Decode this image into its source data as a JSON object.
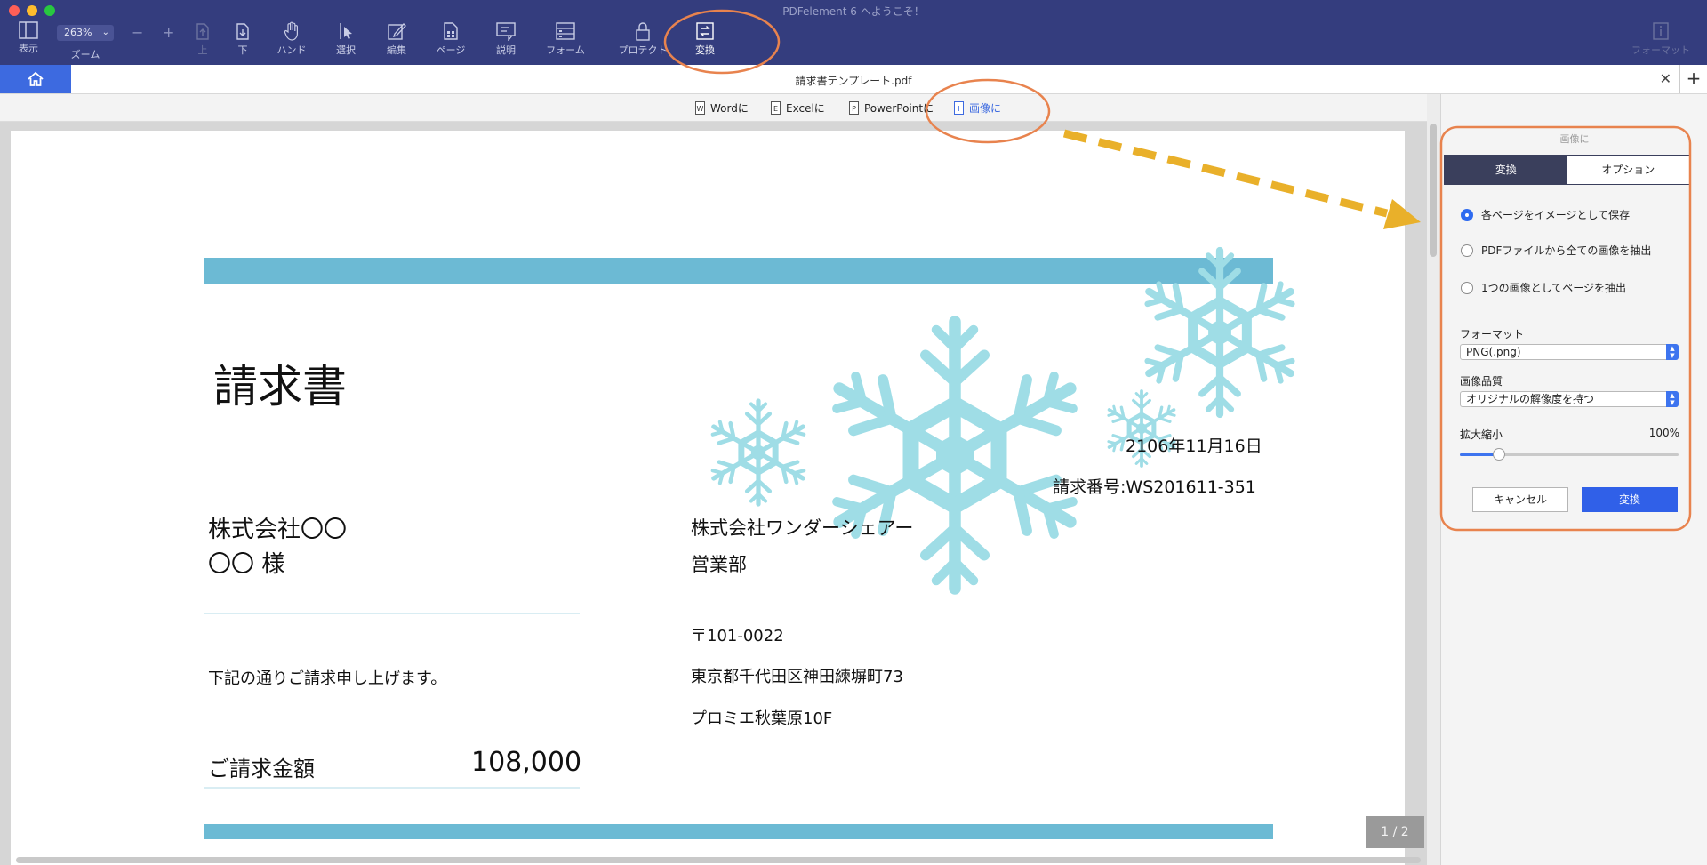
{
  "window": {
    "title": "PDFelement 6 へようこそ！"
  },
  "traffic_lights": {
    "close": "#ff5f57",
    "minimize": "#febc2e",
    "zoom": "#28c840"
  },
  "toolbar": {
    "zoom_value": "263%",
    "zoom_label": "ズーム",
    "tools": [
      {
        "label": "表示",
        "icon": "sidebar-icon"
      },
      {
        "label": "上",
        "icon": "page-up-icon"
      },
      {
        "label": "下",
        "icon": "page-down-icon"
      },
      {
        "label": "ハンド",
        "icon": "hand-icon"
      },
      {
        "label": "選択",
        "icon": "cursor-icon"
      },
      {
        "label": "編集",
        "icon": "edit-icon"
      },
      {
        "label": "ページ",
        "icon": "page-icon"
      },
      {
        "label": "説明",
        "icon": "comment-icon"
      },
      {
        "label": "フォーム",
        "icon": "form-icon"
      },
      {
        "label": "プロテクト",
        "icon": "lock-icon"
      },
      {
        "label": "変換",
        "icon": "convert-icon"
      },
      {
        "label": "フォーマット",
        "icon": "info-icon"
      }
    ]
  },
  "tab": {
    "title": "請求書テンプレート.pdf"
  },
  "convert_bar": {
    "items": [
      {
        "label": "Wordに",
        "glyph": "W"
      },
      {
        "label": "Excelに",
        "glyph": "E"
      },
      {
        "label": "PowerPointに",
        "glyph": "P"
      },
      {
        "label": "画像に",
        "glyph": "I"
      }
    ]
  },
  "document": {
    "title": "請求書",
    "date": "2106年11月16日",
    "invoice_number": "請求番号:WS201611-351",
    "recipient_company": "株式会社〇〇",
    "recipient_person": "〇〇 様",
    "message": "下記の通りご請求申し上げます。",
    "amount_label": "ご請求金額",
    "amount_value": "108,000",
    "sender_company": "株式会社ワンダーシェアー",
    "sender_dept": "営業部",
    "sender_postal": "〒101-0022",
    "sender_address": "東京都千代田区神田練塀町73",
    "sender_building": "プロミエ秋葉原10F",
    "band_color": "#6cbad4",
    "snowflake_color": "#9fdde6"
  },
  "pager": {
    "text": "1 / 2"
  },
  "panel": {
    "header": "画像に",
    "tabs": [
      "変換",
      "オプション"
    ],
    "options": [
      {
        "label": "各ページをイメージとして保存",
        "checked": true
      },
      {
        "label": "PDFファイルから全ての画像を抽出",
        "checked": false
      },
      {
        "label": "1つの画像としてページを抽出",
        "checked": false
      }
    ],
    "format_label": "フォーマット",
    "format_value": "PNG(.png)",
    "quality_label": "画像品質",
    "quality_value": "オリジナルの解像度を持つ",
    "scale_label": "拡大縮小",
    "scale_value": "100%",
    "scale_fraction": 0.18,
    "cancel_label": "キャンセル",
    "convert_label": "変換"
  },
  "annotation_color": "#e8834e",
  "arrow_color": "#e9b02a"
}
